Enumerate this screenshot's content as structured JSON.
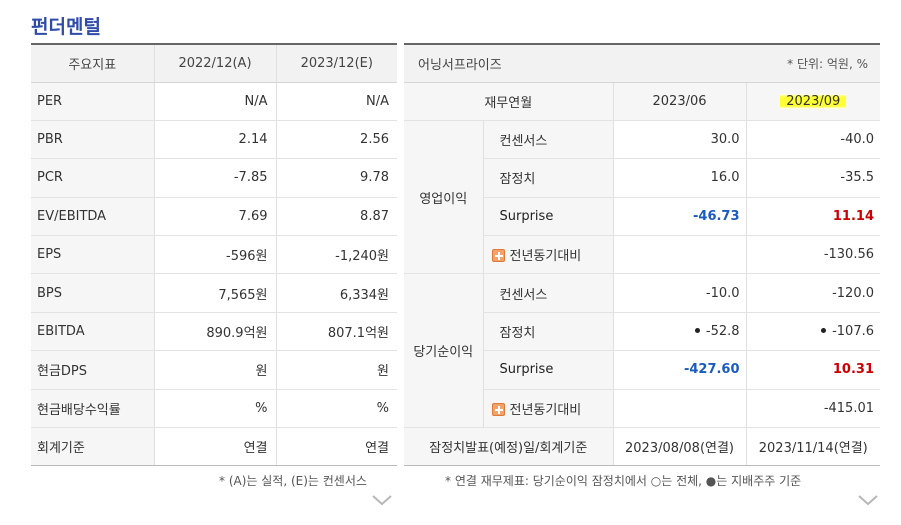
{
  "title": "펀더멘털",
  "left_table": {
    "headers": [
      "주요지표",
      "2022/12(A)",
      "2023/12(E)"
    ],
    "rows": [
      {
        "label": "PER",
        "v1": "N/A",
        "v2": "N/A"
      },
      {
        "label": "PBR",
        "v1": "2.14",
        "v2": "2.56"
      },
      {
        "label": "PCR",
        "v1": "-7.85",
        "v2": "9.78"
      },
      {
        "label": "EV/EBITDA",
        "v1": "7.69",
        "v2": "8.87"
      },
      {
        "label": "EPS",
        "v1": "-596원",
        "v2": "-1,240원"
      },
      {
        "label": "BPS",
        "v1": "7,565원",
        "v2": "6,334원"
      },
      {
        "label": "EBITDA",
        "v1": "890.9억원",
        "v2": "807.1억원"
      },
      {
        "label": "현금DPS",
        "v1": "원",
        "v2": "원"
      },
      {
        "label": "현금배당수익률",
        "v1": "%",
        "v2": "%"
      },
      {
        "label": "회계기준",
        "v1": "연결",
        "v2": "연결"
      }
    ],
    "note": "* (A)는 실적, (E)는 컨센서스"
  },
  "right_table": {
    "title": "어닝서프라이즈",
    "unit": "* 단위: 억원, %",
    "period_head": "재무연월",
    "periods": [
      "2023/06",
      "2023/09"
    ],
    "groups": [
      {
        "name": "영업이익",
        "rows": [
          {
            "label": "컨센서스",
            "v1": "30.0",
            "v2": "-40.0"
          },
          {
            "label": "잠정치",
            "v1": "16.0",
            "v2": "-35.5"
          },
          {
            "label": "Surprise",
            "v1": "-46.73",
            "v2": "11.14"
          },
          {
            "label": "전년동기대비",
            "v1": "",
            "v2": "-130.56"
          }
        ]
      },
      {
        "name": "당기순이익",
        "rows": [
          {
            "label": "컨센서스",
            "v1": "-10.0",
            "v2": "-120.0"
          },
          {
            "label": "잠정치",
            "v1": "-52.8",
            "v2": "-107.6"
          },
          {
            "label": "Surprise",
            "v1": "-427.60",
            "v2": "10.31"
          },
          {
            "label": "전년동기대비",
            "v1": "",
            "v2": "-415.01"
          }
        ]
      }
    ],
    "footer": {
      "label": "잠정치발표(예정)일/회계기준",
      "v1": "2023/08/08(연결)",
      "v2": "2023/11/14(연결)"
    },
    "note": "* 연결 재무제표: 당기순이익 잠정치에서 ○는 전체, ●는 지배주주 기준"
  },
  "colors": {
    "title": "#2f4ca8",
    "positive": "#cc0000",
    "negative": "#1a5bbf",
    "highlight": "#ffff33"
  }
}
